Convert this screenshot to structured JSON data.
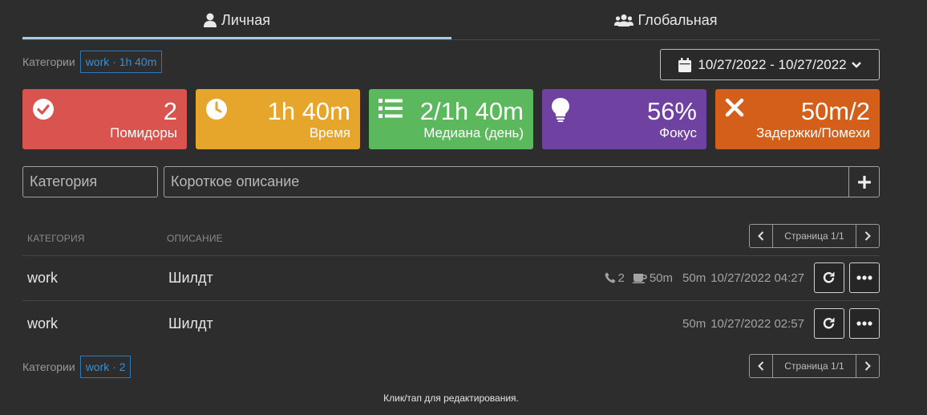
{
  "tabs": [
    {
      "label": "Личная",
      "icon": "user-icon",
      "active": true
    },
    {
      "label": "Глобальная",
      "icon": "users-icon",
      "active": false
    }
  ],
  "categories_bar": {
    "label": "Категории",
    "chip": "work · 1h 40m"
  },
  "date_range": {
    "label": "10/27/2022 - 10/27/2022"
  },
  "stats": [
    {
      "value": "2",
      "label": "Помидоры",
      "icon": "check-circle-icon",
      "color": "#d9534f"
    },
    {
      "value": "1h 40m",
      "label": "Время",
      "icon": "clock-icon",
      "color": "#e5a62b"
    },
    {
      "value": "2/1h 40m",
      "label": "Медиана (день)",
      "icon": "list-icon",
      "color": "#5cb85c"
    },
    {
      "value": "56%",
      "label": "Фокус",
      "icon": "lightbulb-icon",
      "color": "#6f42a1"
    },
    {
      "value": "50m/2",
      "label": "Задержки/Помехи",
      "icon": "times-icon",
      "color": "#d35f1a"
    }
  ],
  "form": {
    "category_placeholder": "Категория",
    "description_placeholder": "Короткое описание"
  },
  "table": {
    "headers": {
      "category": "КАТЕГОРИЯ",
      "description": "ОПИСАНИЕ"
    },
    "pager": "Страница 1/1",
    "rows": [
      {
        "category": "work",
        "description": "Шилдт",
        "calls": "2",
        "breaks": "50m",
        "duration": "50m",
        "timestamp": "10/27/2022 04:27"
      },
      {
        "category": "work",
        "description": "Шилдт",
        "duration": "50m",
        "timestamp": "10/27/2022 02:57"
      }
    ]
  },
  "footer": {
    "categories_label": "Категории",
    "chip": "work · 2",
    "pager": "Страница 1/1",
    "hint": "Клик/тап для редактирования."
  }
}
